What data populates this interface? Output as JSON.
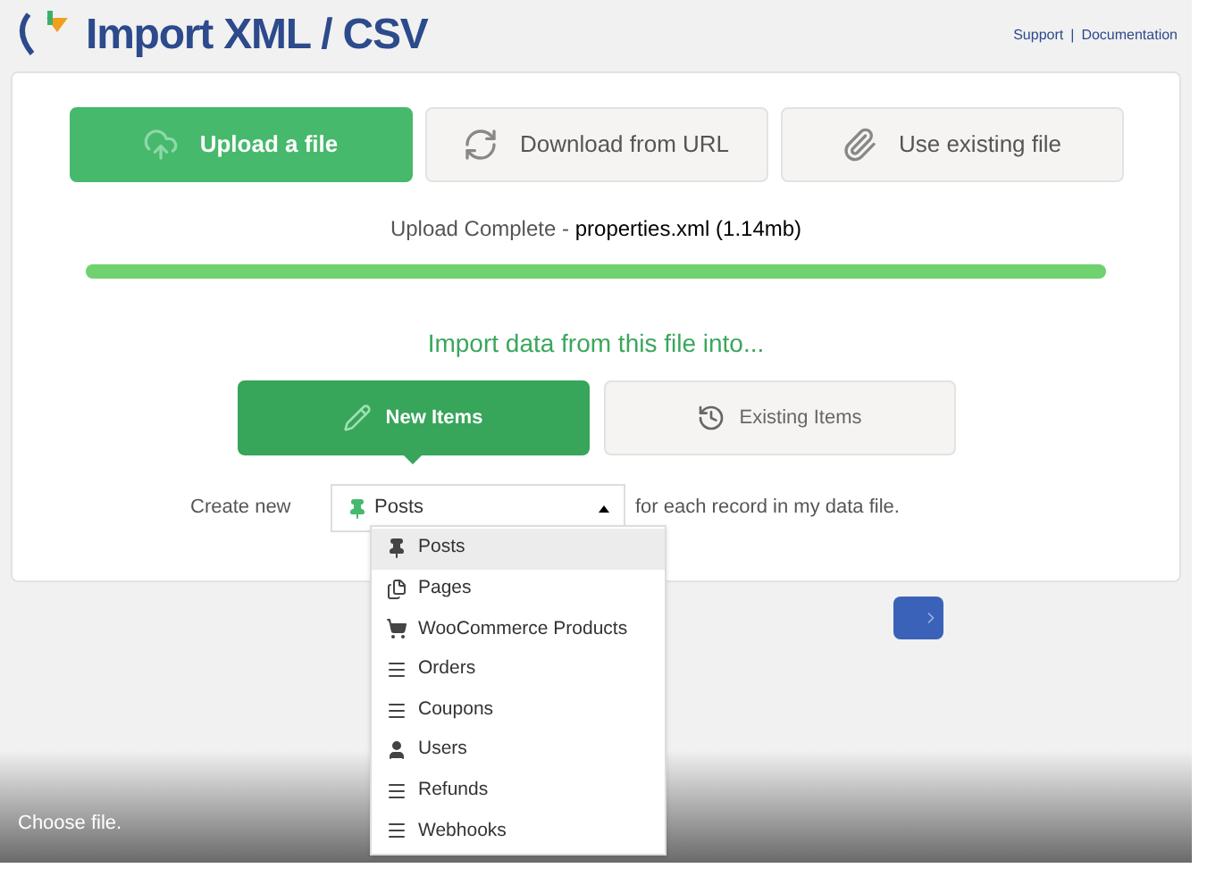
{
  "header": {
    "title": "Import XML / CSV",
    "links": [
      "Support",
      "Documentation"
    ],
    "separator": "|"
  },
  "source_tabs": [
    {
      "label": "Upload a file",
      "kind": "upload",
      "selected": true
    },
    {
      "label": "Download from URL",
      "kind": "url",
      "selected": false
    },
    {
      "label": "Use existing file",
      "kind": "existing",
      "selected": false
    }
  ],
  "upload_status": {
    "label": "Upload Complete",
    "separator": "-",
    "file": "properties.xml (1.14mb)",
    "level": 1
  },
  "import_heading": "Import data from this file into...",
  "target_tabs": [
    {
      "label": "New Items",
      "kind": "new",
      "selected": true
    },
    {
      "label": "Existing Items",
      "kind": "existing",
      "selected": false
    }
  ],
  "create_row": {
    "prefix": "Create new",
    "suffix": "for each record in my data file.",
    "select": {
      "value": "Posts",
      "kind": "pin",
      "expanded": true
    }
  },
  "options": [
    {
      "label": "Posts",
      "kind": "pin",
      "selected": true
    },
    {
      "label": "Pages",
      "kind": "pages",
      "selected": false
    },
    {
      "label": "WooCommerce Products",
      "kind": "cart",
      "selected": false
    },
    {
      "label": "Orders",
      "kind": "list",
      "selected": false
    },
    {
      "label": "Coupons",
      "kind": "list",
      "selected": false
    },
    {
      "label": "Users",
      "kind": "user",
      "selected": false
    },
    {
      "label": "Refunds",
      "kind": "list",
      "selected": false
    },
    {
      "label": "Webhooks",
      "kind": "list",
      "selected": false
    }
  ],
  "caption": "Choose file."
}
